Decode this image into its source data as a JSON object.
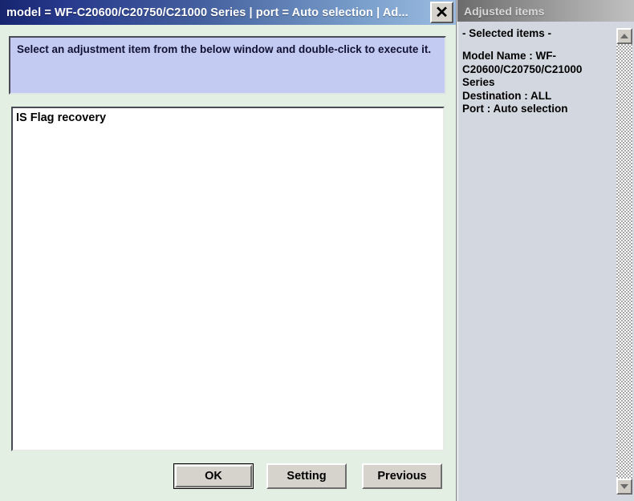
{
  "main_dialog": {
    "title": "model = WF-C20600/C20750/C21000 Series | port = Auto selection | Ad...",
    "close_label": "✕",
    "instruction": "Select an adjustment item from the below window and double-click to execute it.",
    "list_items": [
      "IS Flag recovery"
    ],
    "buttons": {
      "ok": "OK",
      "setting": "Setting",
      "previous": "Previous"
    }
  },
  "side_panel": {
    "title": "Adjusted items",
    "selected_heading": "- Selected items -",
    "lines": [
      "Model Name : WF-C20600/C20750/C21000 Series",
      "Destination : ALL",
      "Port : Auto selection"
    ],
    "scroll_up_icon": "triangle-up-icon",
    "scroll_down_icon": "triangle-down-icon"
  },
  "colors": {
    "dialog_background": "#e2efe2",
    "titlebar_start": "#17256f",
    "titlebar_end": "#9dbde2",
    "instruction_background": "#c3cbf2",
    "side_background": "#d3d8e0",
    "button_face": "#d6d3cd"
  }
}
